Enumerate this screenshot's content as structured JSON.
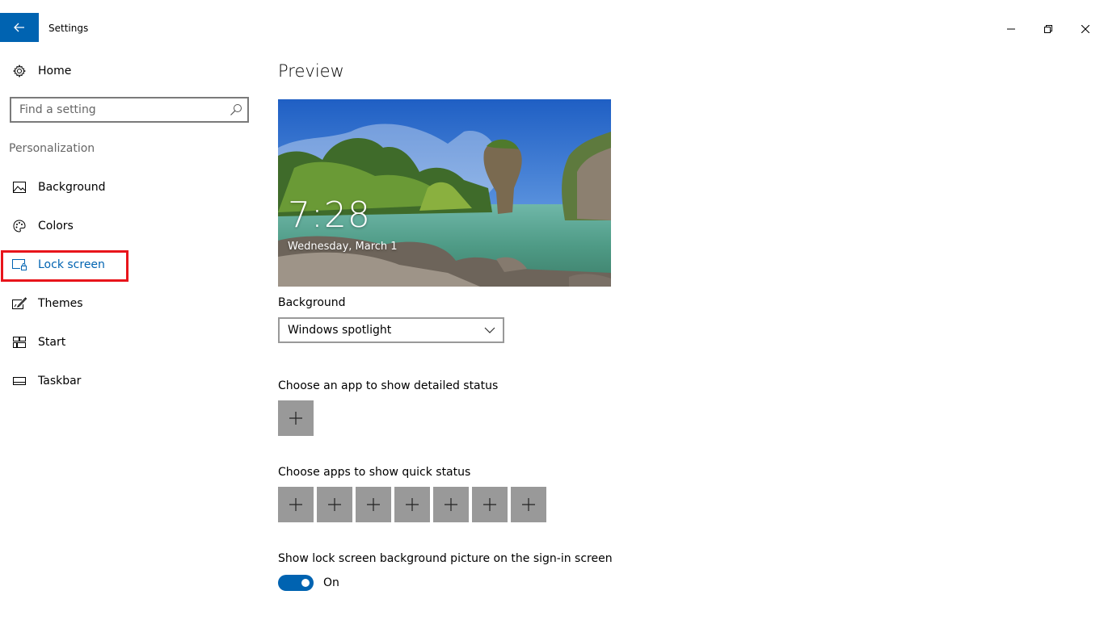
{
  "window": {
    "title": "Settings",
    "accent": "#0063b1"
  },
  "sidebar": {
    "home_label": "Home",
    "search_placeholder": "Find a setting",
    "section_label": "Personalization",
    "items": [
      {
        "label": "Background",
        "icon": "picture-icon"
      },
      {
        "label": "Colors",
        "icon": "palette-icon"
      },
      {
        "label": "Lock screen",
        "icon": "lock-screen-icon",
        "selected": true
      },
      {
        "label": "Themes",
        "icon": "themes-icon"
      },
      {
        "label": "Start",
        "icon": "start-icon"
      },
      {
        "label": "Taskbar",
        "icon": "taskbar-icon"
      }
    ],
    "highlight_color": "#e8141b"
  },
  "main": {
    "title": "Preview",
    "preview": {
      "time": "7:28",
      "date": "Wednesday, March 1"
    },
    "background_label": "Background",
    "background_value": "Windows spotlight",
    "detailed_status_label": "Choose an app to show detailed status",
    "quick_status_label": "Choose apps to show quick status",
    "quick_status_slots": 7,
    "signin_label": "Show lock screen background picture on the sign-in screen",
    "signin_toggle": {
      "on": true,
      "text": "On"
    }
  }
}
